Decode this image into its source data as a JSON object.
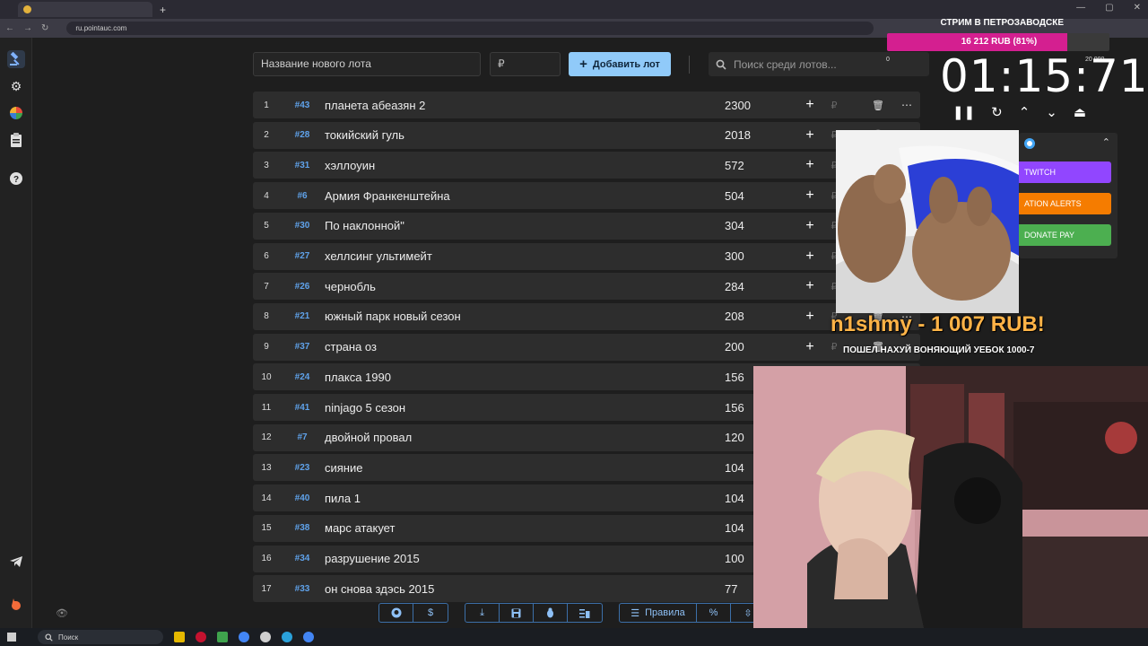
{
  "browser": {
    "url": "ru.pointauc.com"
  },
  "controls": {
    "lot_name_placeholder": "Название нового лота",
    "price_placeholder": "₽",
    "add_button": "Добавить лот",
    "search_placeholder": "Поиск среди лотов..."
  },
  "lots": [
    {
      "index": "1",
      "id": "43",
      "name": "планета абеазян 2",
      "sum": "2300"
    },
    {
      "index": "2",
      "id": "28",
      "name": "токийский гуль",
      "sum": "2018"
    },
    {
      "index": "3",
      "id": "31",
      "name": "хэллоуин",
      "sum": "572"
    },
    {
      "index": "4",
      "id": "6",
      "name": "Армия Франкенштейна",
      "sum": "504"
    },
    {
      "index": "5",
      "id": "30",
      "name": "По наклонной\"",
      "sum": "304"
    },
    {
      "index": "6",
      "id": "27",
      "name": "хеллсинг ультимейт",
      "sum": "300"
    },
    {
      "index": "7",
      "id": "26",
      "name": "чернобль",
      "sum": "284"
    },
    {
      "index": "8",
      "id": "21",
      "name": "южный парк новый сезон",
      "sum": "208"
    },
    {
      "index": "9",
      "id": "37",
      "name": "страна оз",
      "sum": "200"
    },
    {
      "index": "10",
      "id": "24",
      "name": "плакса 1990",
      "sum": "156"
    },
    {
      "index": "11",
      "id": "41",
      "name": "ninjago 5 сезон",
      "sum": "156"
    },
    {
      "index": "12",
      "id": "7",
      "name": " двойной провал",
      "sum": "120"
    },
    {
      "index": "13",
      "id": "23",
      "name": "сияние",
      "sum": "104"
    },
    {
      "index": "14",
      "id": "40",
      "name": "пила 1",
      "sum": "104"
    },
    {
      "index": "15",
      "id": "38",
      "name": "марс атакует",
      "sum": "104"
    },
    {
      "index": "16",
      "id": "34",
      "name": "разрушение 2015",
      "sum": "100"
    },
    {
      "index": "17",
      "id": "33",
      "name": "он снова здэсь 2015",
      "sum": "77"
    }
  ],
  "toolbar": {
    "rules_label": "Правила"
  },
  "taskbar": {
    "search_label": "Поиск"
  },
  "overlay": {
    "stream_title": "СТРИМ В ПЕТРОЗАВОДСКЕ",
    "goal_text": "16 212 RUB (81%)",
    "goal_progress": 0.81,
    "goal_min": "0",
    "goal_max": "20 000",
    "timer": "01:15:71",
    "donation_buttons": [
      "TWITCH",
      "ATION ALERTS",
      "DONATE PAY"
    ],
    "alert_title": "n1shmy - 1 007 RUB!",
    "alert_message": "ПОШЕЛ НАХУЙ ВОНЯЮЩИЙ УЕБОК 1000-7"
  },
  "colors": {
    "accent": "#90caf9",
    "lot_id": "#5fa2ea",
    "goal_fill": "#d41f90",
    "alert_title": "#ffb347"
  }
}
